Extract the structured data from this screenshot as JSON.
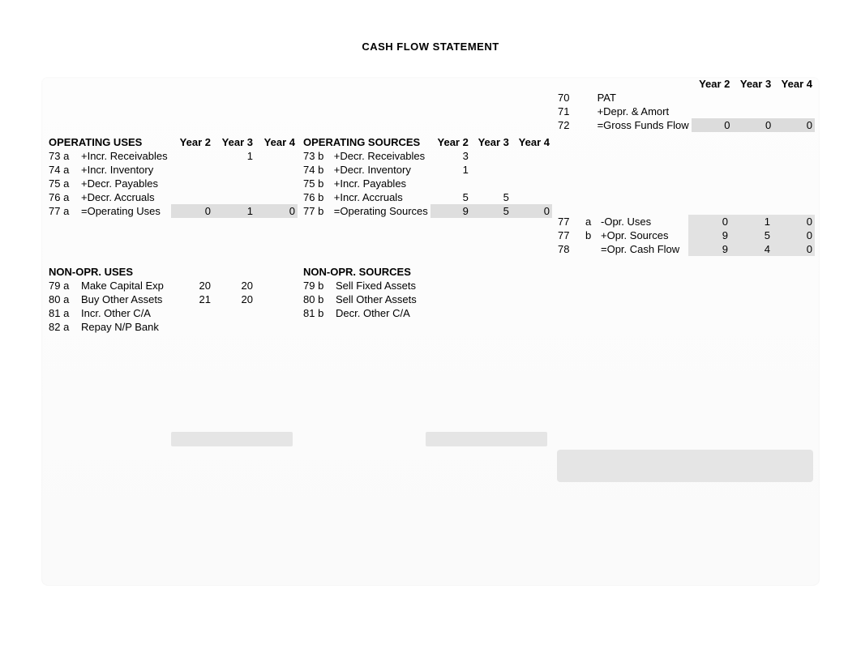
{
  "title": "CASH FLOW STATEMENT",
  "years": {
    "y2": "Year 2",
    "y3": "Year 3",
    "y4": "Year 4"
  },
  "right_top": {
    "rows": [
      {
        "code": "70",
        "sub": "",
        "label": "PAT",
        "y2": "",
        "y3": "",
        "y4": ""
      },
      {
        "code": "71",
        "sub": "",
        "label": "+Depr. & Amort",
        "y2": "",
        "y3": "",
        "y4": ""
      },
      {
        "code": "72",
        "sub": "",
        "label": "=Gross Funds Flow",
        "y2": "0",
        "y3": "0",
        "y4": "0",
        "sum": true
      }
    ]
  },
  "op_uses": {
    "header": "OPERATING USES",
    "rows": [
      {
        "code": "73 a",
        "label": "+Incr. Receivables",
        "y2": "",
        "y3": "1",
        "y4": ""
      },
      {
        "code": "74 a",
        "label": "+Incr. Inventory",
        "y2": "",
        "y3": "",
        "y4": ""
      },
      {
        "code": "75 a",
        "label": "+Decr. Payables",
        "y2": "",
        "y3": "",
        "y4": ""
      },
      {
        "code": "76 a",
        "label": "+Decr. Accruals",
        "y2": "",
        "y3": "",
        "y4": ""
      },
      {
        "code": "77 a",
        "label": "=Operating Uses",
        "y2": "0",
        "y3": "1",
        "y4": "0",
        "sum": true
      }
    ]
  },
  "op_sources": {
    "header": "OPERATING SOURCES",
    "rows": [
      {
        "code": "73 b",
        "label": "+Decr. Receivables",
        "y2": "3",
        "y3": "",
        "y4": ""
      },
      {
        "code": "74 b",
        "label": "+Decr. Inventory",
        "y2": "1",
        "y3": "",
        "y4": ""
      },
      {
        "code": "75 b",
        "label": "+Incr. Payables",
        "y2": "",
        "y3": "",
        "y4": ""
      },
      {
        "code": "76 b",
        "label": "+Incr. Accruals",
        "y2": "5",
        "y3": "5",
        "y4": ""
      },
      {
        "code": "77 b",
        "label": "=Operating Sources",
        "y2": "9",
        "y3": "5",
        "y4": "0",
        "sum": true
      }
    ]
  },
  "right_ops": {
    "rows": [
      {
        "code": "77",
        "sub": "a",
        "label": "-Opr. Uses",
        "y2": "0",
        "y3": "1",
        "y4": "0",
        "band": true
      },
      {
        "code": "77",
        "sub": "b",
        "label": "+Opr. Sources",
        "y2": "9",
        "y3": "5",
        "y4": "0",
        "band": true
      },
      {
        "code": "78",
        "sub": "",
        "label": "=Opr. Cash Flow",
        "y2": "9",
        "y3": "4",
        "y4": "0",
        "band": true
      }
    ]
  },
  "nonop_uses": {
    "header": "NON-OPR. USES",
    "rows": [
      {
        "code": "79 a",
        "label": "Make Capital Exp",
        "y2": "20",
        "y3": "20",
        "y4": ""
      },
      {
        "code": "80 a",
        "label": "Buy Other Assets",
        "y2": "21",
        "y3": "20",
        "y4": ""
      },
      {
        "code": "81 a",
        "label": "Incr. Other C/A",
        "y2": "",
        "y3": "",
        "y4": ""
      },
      {
        "code": "82 a",
        "label": "Repay N/P Bank",
        "y2": "",
        "y3": "",
        "y4": ""
      }
    ]
  },
  "nonop_sources": {
    "header": "NON-OPR. SOURCES",
    "rows": [
      {
        "code": "79 b",
        "label": "Sell Fixed Assets",
        "y2": "",
        "y3": "",
        "y4": ""
      },
      {
        "code": "80 b",
        "label": "Sell Other Assets",
        "y2": "",
        "y3": "",
        "y4": ""
      },
      {
        "code": "81 b",
        "label": "Decr. Other C/A",
        "y2": "",
        "y3": "",
        "y4": ""
      }
    ]
  }
}
